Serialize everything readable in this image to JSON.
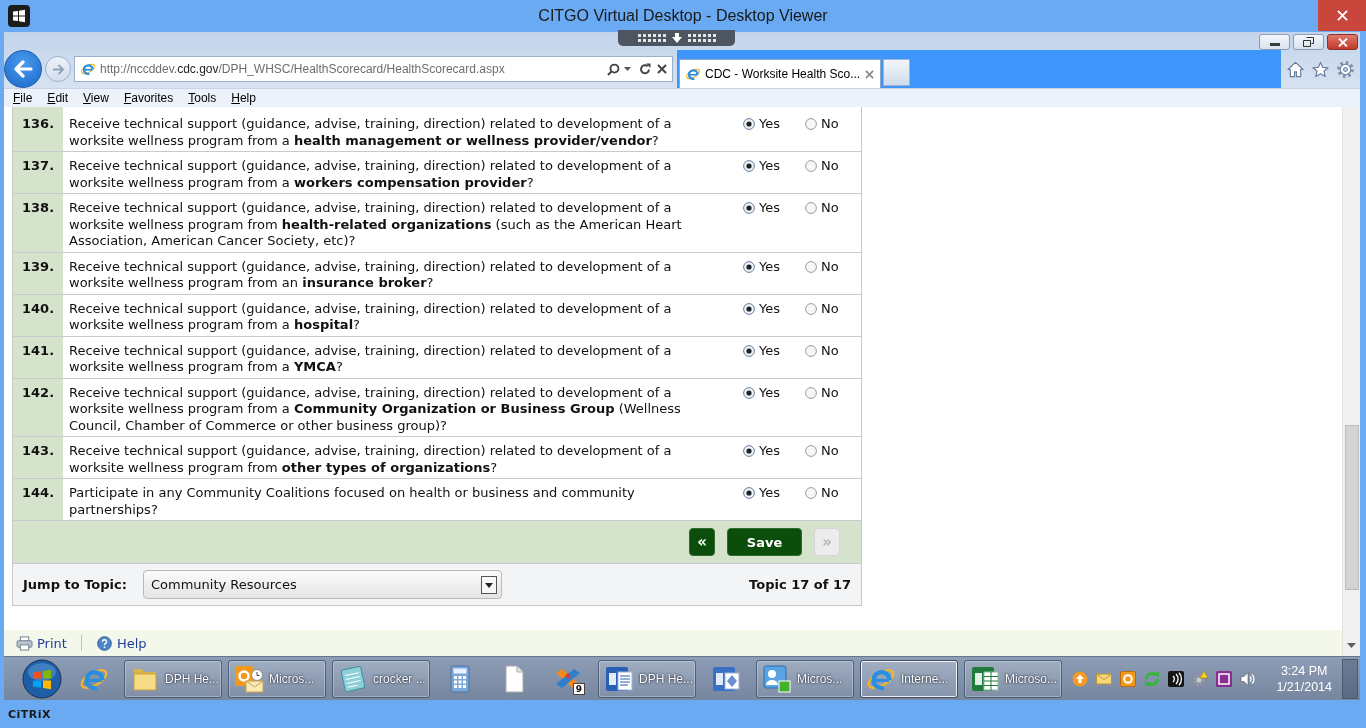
{
  "viewer": {
    "title": "CITGO Virtual Desktop - Desktop Viewer",
    "brand": "CiTRiX"
  },
  "browser": {
    "address": {
      "scheme": "http://nccddev.",
      "domain": "cdc.gov",
      "path": "/DPH_WHSC/HealthScorecard/HealthScorecard.aspx"
    },
    "tabs": [
      {
        "label": "CDC - Worksite Health Sco...",
        "selected": true
      }
    ],
    "menu": [
      "File",
      "Edit",
      "View",
      "Favorites",
      "Tools",
      "Help"
    ]
  },
  "questions": [
    {
      "number": "136.",
      "text": "Receive technical support (guidance, advise, training, direction) related to development of a worksite wellness program from a **health management or wellness provider/vendor**?",
      "options": [
        {
          "label": "Yes",
          "selected": true
        },
        {
          "label": "No",
          "selected": false
        }
      ]
    },
    {
      "number": "137.",
      "text": "Receive technical support (guidance, advise, training, direction) related to development of a worksite wellness program from a **workers compensation provider**?",
      "options": [
        {
          "label": "Yes",
          "selected": true
        },
        {
          "label": "No",
          "selected": false
        }
      ]
    },
    {
      "number": "138.",
      "text": "Receive technical support (guidance, advise, training, direction) related to development of a worksite wellness program from **health-related organizations** (such as the American Heart Association, American Cancer Society, etc)?",
      "options": [
        {
          "label": "Yes",
          "selected": true
        },
        {
          "label": "No",
          "selected": false
        }
      ]
    },
    {
      "number": "139.",
      "text": "Receive technical support (guidance, advise, training, direction) related to development of a worksite wellness program from an **insurance broker**?",
      "options": [
        {
          "label": "Yes",
          "selected": true
        },
        {
          "label": "No",
          "selected": false
        }
      ]
    },
    {
      "number": "140.",
      "text": "Receive technical support (guidance, advise, training, direction) related to development of a worksite wellness program from a **hospital**?",
      "options": [
        {
          "label": "Yes",
          "selected": true
        },
        {
          "label": "No",
          "selected": false
        }
      ]
    },
    {
      "number": "141.",
      "text": "Receive technical support (guidance, advise, training, direction) related to development of a worksite wellness program from a **YMCA**?",
      "options": [
        {
          "label": "Yes",
          "selected": true
        },
        {
          "label": "No",
          "selected": false
        }
      ]
    },
    {
      "number": "142.",
      "text": "Receive technical support (guidance, advise, training, direction) related to development of a worksite wellness program from a **Community Organization or Business Group** (Wellness Council, Chamber of Commerce or other business group)?",
      "options": [
        {
          "label": "Yes",
          "selected": true
        },
        {
          "label": "No",
          "selected": false
        }
      ]
    },
    {
      "number": "143.",
      "text": "Receive technical support (guidance, advise, training, direction) related to development of a worksite wellness program from **other types of organizations**?",
      "options": [
        {
          "label": "Yes",
          "selected": true
        },
        {
          "label": "No",
          "selected": false
        }
      ]
    },
    {
      "number": "144.",
      "text": "Participate in any Community Coalitions focused on health or business and community partnerships?",
      "options": [
        {
          "label": "Yes",
          "selected": true
        },
        {
          "label": "No",
          "selected": false
        }
      ]
    }
  ],
  "navigation": [
    {
      "kind": "previous",
      "label": "«",
      "disabled": false
    },
    {
      "kind": "save",
      "label": "Save",
      "disabled": false
    },
    {
      "kind": "next",
      "label": "»",
      "disabled": true
    }
  ],
  "topic": {
    "label": "Jump to Topic:",
    "value": "Community Resources",
    "counter": "Topic 17 of 17"
  },
  "footer_links": [
    {
      "kind": "print",
      "label": "Print"
    },
    {
      "kind": "help",
      "label": "Help"
    }
  ],
  "taskbar": {
    "items": [
      {
        "kind": "browser",
        "selected": false
      },
      {
        "kind": "folder",
        "label": "DPH He...",
        "selected": false
      },
      {
        "kind": "mail",
        "label": "Micros...",
        "selected": false
      },
      {
        "kind": "notepad",
        "label": "crocker ...",
        "selected": false
      },
      {
        "kind": "calculator",
        "selected": false
      },
      {
        "kind": "document",
        "selected": false
      },
      {
        "kind": "tool",
        "badge": "9",
        "selected": false
      },
      {
        "kind": "word",
        "label": "DPH He...",
        "selected": false
      },
      {
        "kind": "visio",
        "selected": false
      },
      {
        "kind": "chat",
        "label": "Micros...",
        "selected": false
      },
      {
        "kind": "browser",
        "label": "Interne...",
        "selected": true
      },
      {
        "kind": "sheet",
        "label": "Microso...",
        "selected": false
      }
    ],
    "clock": {
      "time": "3:24 PM",
      "date": "1/21/2014"
    }
  }
}
